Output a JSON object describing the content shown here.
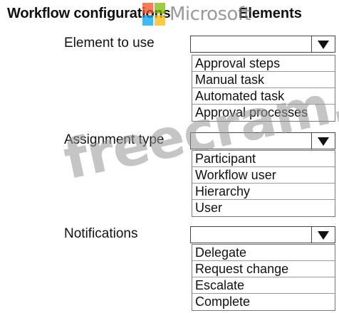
{
  "header": {
    "left_title": "Workflow configurations",
    "right_title": "Elements"
  },
  "watermarks": {
    "logo_icon": "microsoft-logo-icon",
    "logo_word": "Microsoft",
    "site": "freecram.net"
  },
  "colors": {
    "ms_red": "#f25022",
    "ms_green": "#7fba00",
    "ms_blue": "#00a4ef",
    "ms_yellow": "#ffb900"
  },
  "sections": [
    {
      "label": "Element to use",
      "selected_value": "",
      "options": [
        "Approval steps",
        "Manual task",
        "Automated task",
        "Approval processes"
      ]
    },
    {
      "label": "Assignment type",
      "selected_value": "",
      "options": [
        "Participant",
        "Workflow user",
        "Hierarchy",
        "User"
      ]
    },
    {
      "label": "Notifications",
      "selected_value": "",
      "options": [
        "Delegate",
        "Request change",
        "Escalate",
        "Complete"
      ]
    }
  ]
}
